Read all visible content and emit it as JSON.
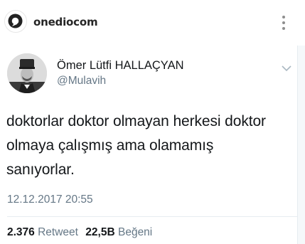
{
  "post_header": {
    "username": "onediocom",
    "avatar_icon": "onedio-logo-icon",
    "more_icon": "more-dots-icon"
  },
  "tweet": {
    "author_name": "Ömer Lütfi HALLAÇYAN",
    "author_handle": "@Mulavih",
    "text_lines": [
      "doktorlar doktor olmayan herkesi doktor",
      "olmaya çalışmış ama olamamış",
      "sanıyorlar."
    ],
    "timestamp": "12.12.2017 20:55",
    "retweet_count": "2.376",
    "retweet_label": "Retweet",
    "like_count": "22,5B",
    "like_label": "Beğeni",
    "menu_icon": "chevron-down-icon"
  },
  "colors": {
    "primary_text": "#14171a",
    "secondary_text": "#657786",
    "divider": "#e6ecf0",
    "instagram_text": "#262626"
  }
}
